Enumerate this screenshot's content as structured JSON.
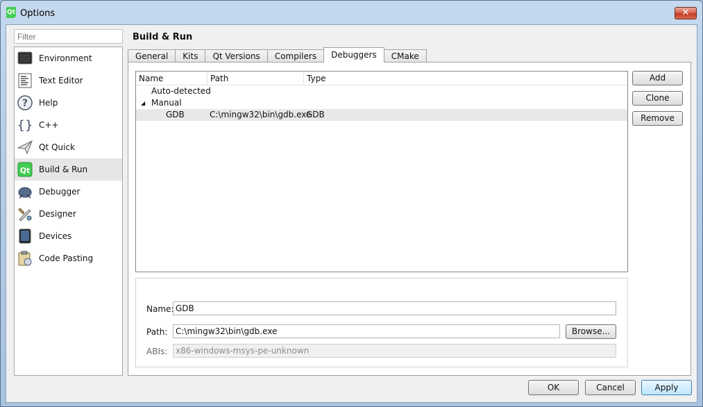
{
  "window": {
    "title": "Options",
    "app_icon": "qt-logo-icon",
    "close_glyph": "✕"
  },
  "sidebar": {
    "filter_placeholder": "Filter",
    "items": [
      {
        "label": "Environment",
        "icon": "monitor-icon"
      },
      {
        "label": "Text Editor",
        "icon": "document-icon"
      },
      {
        "label": "Help",
        "icon": "help-icon"
      },
      {
        "label": "C++",
        "icon": "braces-icon"
      },
      {
        "label": "Qt Quick",
        "icon": "paper-plane-icon"
      },
      {
        "label": "Build & Run",
        "icon": "build-run-icon"
      },
      {
        "label": "Debugger",
        "icon": "bug-icon"
      },
      {
        "label": "Designer",
        "icon": "designer-tools-icon"
      },
      {
        "label": "Devices",
        "icon": "tablet-icon"
      },
      {
        "label": "Code Pasting",
        "icon": "clipboard-icon"
      }
    ],
    "selected": "Build & Run"
  },
  "page": {
    "title": "Build & Run",
    "tabs": [
      "General",
      "Kits",
      "Qt Versions",
      "Compilers",
      "Debuggers",
      "CMake"
    ],
    "active_tab": "Debuggers"
  },
  "debuggers": {
    "columns": [
      "Name",
      "Path",
      "Type"
    ],
    "groups": [
      {
        "label": "Auto-detected",
        "expanded": false
      },
      {
        "label": "Manual",
        "expanded": true,
        "expander": "◢"
      }
    ],
    "rows": [
      {
        "name": "GDB",
        "path": "C:\\mingw32\\bin\\gdb.exe",
        "type": "GDB",
        "selected": true
      }
    ],
    "buttons": {
      "add": "Add",
      "clone": "Clone",
      "remove": "Remove"
    }
  },
  "details": {
    "name_label": "Name:",
    "name_value": "GDB",
    "path_label": "Path:",
    "path_value": "C:\\mingw32\\bin\\gdb.exe",
    "browse_label": "Browse...",
    "abis_label": "ABIs:",
    "abis_value": "x86-windows-msys-pe-unknown"
  },
  "dialog_buttons": {
    "ok": "OK",
    "cancel": "Cancel",
    "apply": "Apply"
  }
}
